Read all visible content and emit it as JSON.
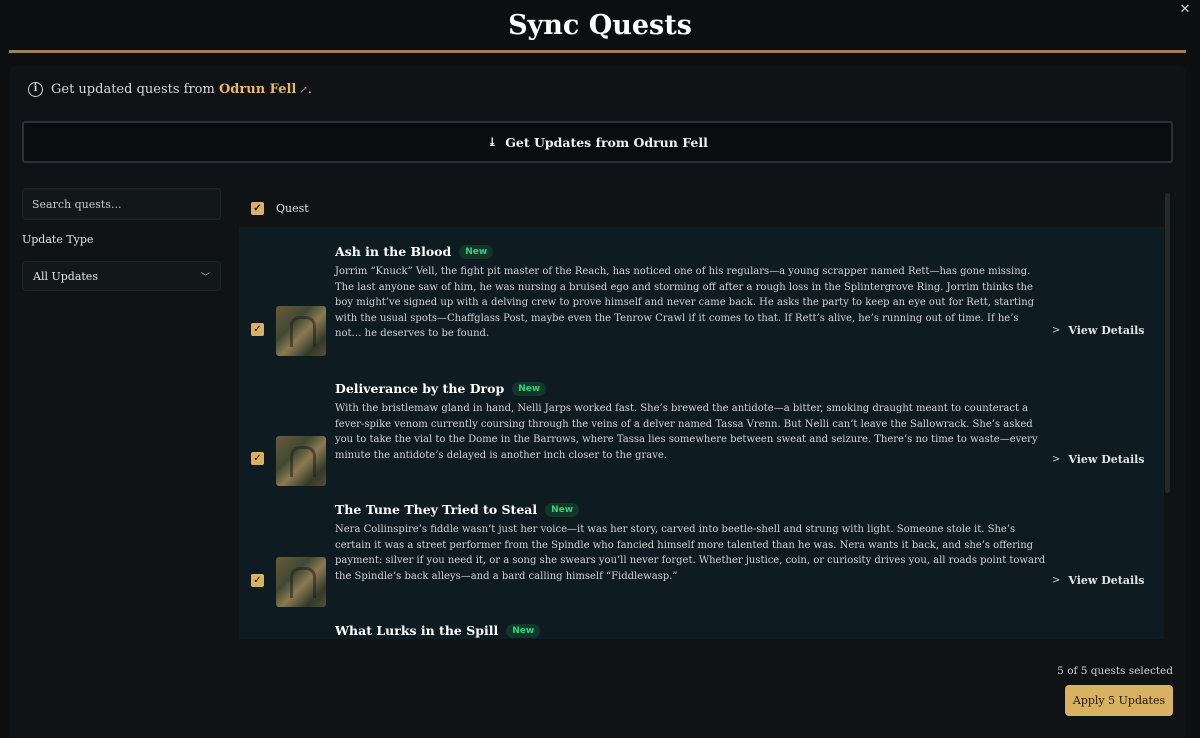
{
  "dialog": {
    "title": "Sync Quests",
    "close_glyph": "✕"
  },
  "info": {
    "prefix": "Get updated quests from",
    "source": "Odrun Fell",
    "suffix": ".",
    "icon": "info-icon",
    "link_icon": "external-link-icon"
  },
  "get_updates": {
    "label": "Get Updates from Odrun Fell",
    "icon": "download-icon"
  },
  "sidebar": {
    "search_placeholder": "Search quests...",
    "filter_label": "Update Type",
    "filter_value": "All Updates"
  },
  "table": {
    "header": "Quest",
    "rows": [
      {
        "title": "Ash in the Blood",
        "badge": "New",
        "description": "Jorrim “Knuck” Vell, the fight pit master of the Reach, has noticed one of his regulars—a young scrapper named Rett—has gone missing. The last anyone saw of him, he was nursing a bruised ego and storming off after a rough loss in the Splintergrove Ring. Jorrim thinks the boy might’ve signed up with a delving crew to prove himself and never came back. He asks the party to keep an eye out for Rett, starting with the usual spots—Chaffglass Post, maybe even the Tenrow Crawl if it comes to that. If Rett’s alive, he’s running out of time. If he’s not… he deserves to be found.",
        "action": "View Details",
        "checked": true
      },
      {
        "title": "Deliverance by the Drop",
        "badge": "New",
        "description": "With the bristlemaw gland in hand, Nelli Jarps worked fast. She’s brewed the antidote—a bitter, smoking draught meant to counteract a fever-spike venom currently coursing through the veins of a delver named Tassa Vrenn. But Nelli can’t leave the Sallowrack. She’s asked you to take the vial to the Dome in the Barrows, where Tassa lies somewhere between sweat and seizure. There’s no time to waste—every minute the antidote’s delayed is another inch closer to the grave.",
        "action": "View Details",
        "checked": true
      },
      {
        "title": "The Tune They Tried to Steal",
        "badge": "New",
        "description": "Nera Collinspire’s fiddle wasn’t just her voice—it was her story, carved into beetle-shell and strung with light. Someone stole it. She’s certain it was a street performer from the Spindle who fancied himself more talented than he was. Nera wants it back, and she’s offering payment: silver if you need it, or a song she swears you’ll never forget. Whether justice, coin, or curiosity drives you, all roads point toward the Spindle’s back alleys—and a bard calling himself “Fiddlewasp.”",
        "action": "View Details",
        "checked": true
      },
      {
        "title": "What Lurks in the Spill",
        "badge": "New",
        "description": "",
        "action": "",
        "checked": true
      }
    ]
  },
  "footer": {
    "selected_text": "5 of 5 quests selected",
    "apply_label": "Apply 5 Updates"
  },
  "colors": {
    "accent_gold": "#d8b163",
    "link_gold": "#e3b866",
    "badge_green": "#2fd27d",
    "row_bg": "#0e1c22"
  }
}
